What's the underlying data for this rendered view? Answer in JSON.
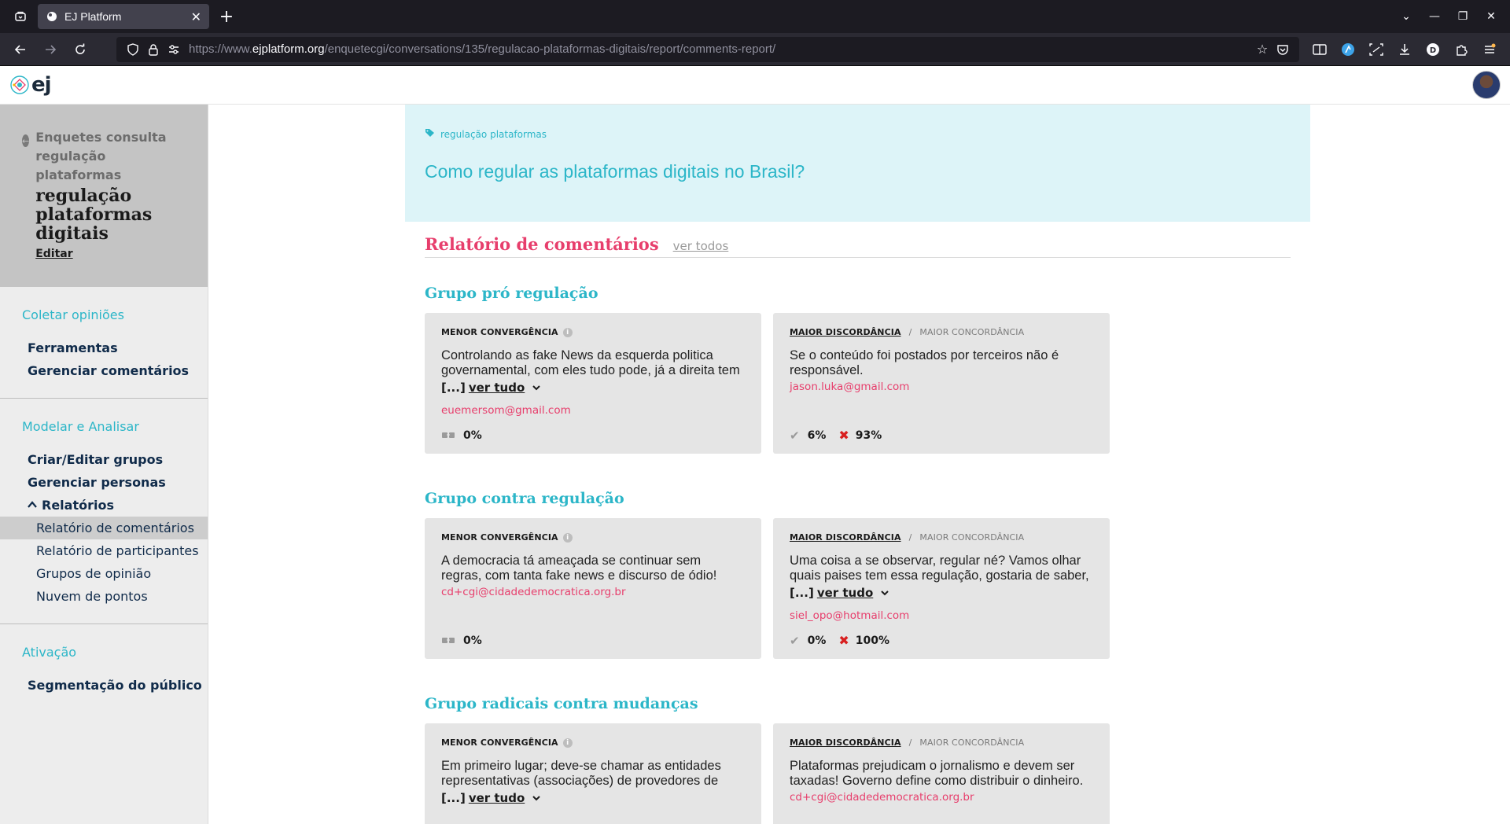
{
  "browser": {
    "tab_title": "EJ Platform",
    "url_prefix": "https://www.",
    "url_host": "ejplatform.org",
    "url_path": "/enquetecgi/conversations/135/regulacao-plataformas-digitais/report/comments-report/"
  },
  "header": {
    "logo": "ej"
  },
  "sidebar": {
    "parent": "Enquetes consulta regulação plataformas",
    "title": "regulação plataformas digitais",
    "edit": "Editar",
    "sections": [
      {
        "heading": "Coletar opiniões",
        "items": [
          "Ferramentas",
          "Gerenciar comentários"
        ]
      },
      {
        "heading": "Modelar e Analisar",
        "items": [
          "Criar/Editar grupos",
          "Gerenciar personas"
        ],
        "expanded": "Relatórios",
        "sub": [
          "Relatório de comentários",
          "Relatório de participantes",
          "Grupos de opinião",
          "Nuvem de pontos"
        ]
      },
      {
        "heading": "Ativação",
        "items": [
          "Segmentação do público"
        ]
      }
    ]
  },
  "hero": {
    "tag": "regulação plataformas",
    "question": "Como regular as plataformas digitais no Brasil?"
  },
  "report": {
    "title": "Relatório de comentários",
    "see_all": "ver todos",
    "labels": {
      "less_convergence": "MENOR CONVERGÊNCIA",
      "more_disagree": "MAIOR DISCORDÂNCIA",
      "more_agree": "MAIOR CONCORDÂNCIA",
      "see_all_text": "ver tudo",
      "ellipsis": "[...]"
    },
    "groups": [
      {
        "name": "Grupo pró regulação",
        "left": {
          "text": "Controlando as fake News da esquerda politica governamental, com eles tudo pode, já a direita tem",
          "author": "euemersom@gmail.com",
          "stat": "0%",
          "truncated": true
        },
        "right": {
          "text": "Se o conteúdo foi postados por terceiros não é responsável.",
          "author": "jason.luka@gmail.com",
          "agree": "6%",
          "disagree": "93%",
          "truncated": false
        }
      },
      {
        "name": "Grupo contra regulação",
        "left": {
          "text": "A democracia tá ameaçada se continuar sem regras, com tanta fake news e discurso de ódio!",
          "author": "cd+cgi@cidadedemocratica.org.br",
          "stat": "0%",
          "truncated": false
        },
        "right": {
          "text": "Uma coisa a se observar, regular né? Vamos olhar quais paises tem essa regulação, gostaria de saber,",
          "author": "siel_opo@hotmail.com",
          "agree": "0%",
          "disagree": "100%",
          "truncated": true
        }
      },
      {
        "name": "Grupo radicais contra mudanças",
        "left": {
          "text": "Em primeiro lugar; deve-se chamar as entidades representativas (associações) de provedores de",
          "author": "",
          "stat": "",
          "truncated": true
        },
        "right": {
          "text": "Plataformas prejudicam o jornalismo e devem ser taxadas! Governo define como distribuir o dinheiro.",
          "author": "cd+cgi@cidadedemocratica.org.br",
          "agree": "",
          "disagree": "",
          "truncated": false
        }
      }
    ]
  }
}
